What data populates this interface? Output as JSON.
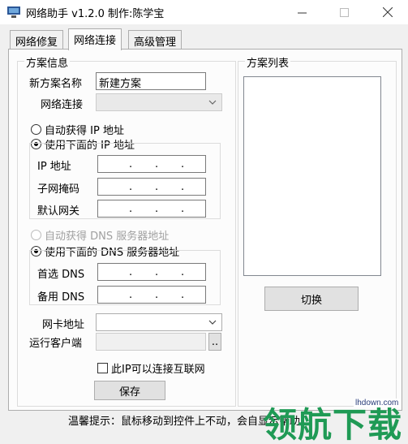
{
  "window": {
    "title": "网络助手 v1.2.0 制作:陈学宝"
  },
  "tabs": [
    {
      "label": "网络修复"
    },
    {
      "label": "网络连接"
    },
    {
      "label": "高级管理"
    }
  ],
  "scheme_info": {
    "group_title": "方案信息",
    "new_scheme_label": "新方案名称",
    "new_scheme_value": "新建方案",
    "connection_label": "网络连接",
    "connection_value": "",
    "ip_auto_label": "自动获得 IP 地址",
    "ip_manual_label": "使用下面的 IP 地址",
    "ip_address_label": "IP 地址",
    "subnet_label": "子网掩码",
    "gateway_label": "默认网关",
    "dns_auto_label": "自动获得 DNS 服务器地址",
    "dns_manual_label": "使用下面的 DNS 服务器地址",
    "dns_primary_label": "首选 DNS",
    "dns_secondary_label": "备用 DNS",
    "mac_label": "网卡地址",
    "mac_value": "",
    "client_label": "运行客户端",
    "client_value": "",
    "browse_label": "..",
    "internet_check_label": "此IP可以连接互联网",
    "save_label": "保存",
    "ip_dot": "."
  },
  "scheme_list": {
    "group_title": "方案列表",
    "switch_label": "切换"
  },
  "status": {
    "hint": "温馨提示：鼠标移动到控件上不动，会自显示帮助"
  },
  "watermark": {
    "text": "领航下载",
    "url": "lhdown.com"
  },
  "colors": {
    "panel": "#fcfcfc",
    "window": "#f0f0f0",
    "watermark": "#1f9a55"
  }
}
